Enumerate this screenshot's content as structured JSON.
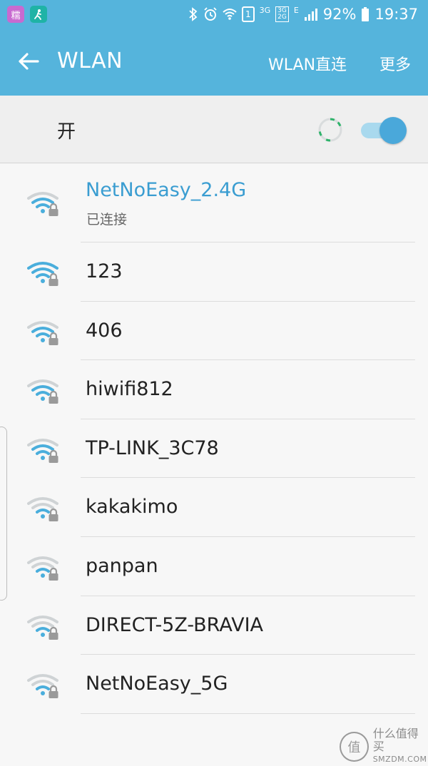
{
  "status_bar": {
    "app1_icon": "app-icon-purple",
    "app1_label": "糯",
    "app2_icon": "app-icon-teal",
    "sim_slot": "1",
    "network_3g": "3G",
    "network_stack_top": "3G",
    "network_stack_bottom": "2G",
    "network_e": "E",
    "battery": "92%",
    "time": "19:37",
    "colors": {
      "background": "#55b4dc"
    }
  },
  "app_bar": {
    "title": "WLAN",
    "wifi_direct_label": "WLAN直连",
    "more_label": "更多",
    "back_icon": "arrow-left-icon"
  },
  "toggle": {
    "label": "开",
    "state": "on",
    "scanning": true
  },
  "networks": [
    {
      "name": "NetNoEasy_2.4G",
      "status": "已连接",
      "signal": 3,
      "secured": true,
      "connected": true
    },
    {
      "name": "123",
      "signal": 4,
      "secured": true
    },
    {
      "name": "406",
      "signal": 3,
      "secured": true
    },
    {
      "name": "hiwifi812",
      "signal": 3,
      "secured": true
    },
    {
      "name": "TP-LINK_3C78",
      "signal": 3,
      "secured": true
    },
    {
      "name": "kakakimo",
      "signal": 2,
      "secured": true
    },
    {
      "name": "panpan",
      "signal": 2,
      "secured": true
    },
    {
      "name": "DIRECT-5Z-BRAVIA",
      "signal": 2,
      "secured": true
    },
    {
      "name": "NetNoEasy_5G",
      "signal": 2,
      "secured": true
    }
  ],
  "watermark": {
    "logo_glyph": "值",
    "cn": "什么值得买",
    "en": "SMZDM.COM"
  },
  "colors": {
    "accent": "#55b4dc",
    "connected_text": "#3a9dd1",
    "signal_active": "#4aaedc",
    "signal_inactive": "#cfd3d5",
    "lock": "#9a9a9a"
  }
}
